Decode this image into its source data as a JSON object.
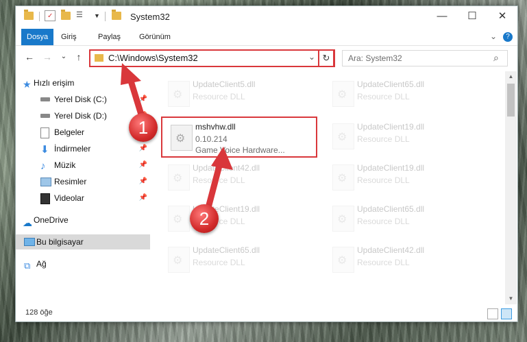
{
  "window": {
    "title": "System32",
    "minimize": "—",
    "maximize": "☐",
    "close": "✕"
  },
  "ribbon": {
    "tabs": [
      {
        "label": "Dosya",
        "active": true
      },
      {
        "label": "Giriş"
      },
      {
        "label": "Paylaş"
      },
      {
        "label": "Görünüm"
      }
    ],
    "expand": "⌄",
    "help": "?"
  },
  "nav": {
    "back": "←",
    "forward": "→",
    "recent": "⌄",
    "up": "↑",
    "address": "C:\\Windows\\System32",
    "address_dropdown": "⌄",
    "refresh": "↻",
    "search_placeholder": "Ara: System32",
    "search_icon": "⌕"
  },
  "sidebar": {
    "items": [
      {
        "label": "Hızlı erişim",
        "icon": "star-icon"
      },
      {
        "label": "Yerel Disk (C:)",
        "icon": "drive-icon",
        "pinned": true
      },
      {
        "label": "Yerel Disk (D:)",
        "icon": "drive-icon",
        "pinned": true
      },
      {
        "label": "Belgeler",
        "icon": "documents-icon",
        "pinned": true
      },
      {
        "label": "İndirmeler",
        "icon": "download-icon",
        "pinned": true
      },
      {
        "label": "Müzik",
        "icon": "music-icon",
        "pinned": true
      },
      {
        "label": "Resimler",
        "icon": "pictures-icon",
        "pinned": true
      },
      {
        "label": "Videolar",
        "icon": "videos-icon",
        "pinned": true
      },
      {
        "label": "OneDrive",
        "icon": "cloud-icon"
      },
      {
        "label": "Bu bilgisayar",
        "icon": "computer-icon",
        "selected": true
      },
      {
        "label": "Ağ",
        "icon": "network-icon"
      }
    ]
  },
  "files": {
    "left": [
      {
        "name": "UpdateClient5.dll",
        "type": "Resource DLL"
      },
      {
        "name": "mshvhw.dll",
        "version": "0.10.214",
        "description": "Game Voice Hardware..."
      },
      {
        "name": "UpdateClient42.dll",
        "type": "Resource DLL"
      },
      {
        "name": "UpdateClient19.dll",
        "type": "Resource DLL"
      },
      {
        "name": "UpdateClient65.dll",
        "type": "Resource DLL"
      }
    ],
    "right": [
      {
        "name": "UpdateClient65.dll",
        "type": "Resource DLL"
      },
      {
        "name": "UpdateClient19.dll",
        "type": "Resource DLL"
      },
      {
        "name": "UpdateClient19.dll",
        "type": "Resource DLL"
      },
      {
        "name": "UpdateClient65.dll",
        "type": "Resource DLL"
      },
      {
        "name": "UpdateClient42.dll",
        "type": "Resource DLL"
      }
    ]
  },
  "status": {
    "count": "128 öğe"
  },
  "annotations": {
    "badge1": "1",
    "badge2": "2",
    "color": "#d9373b"
  }
}
